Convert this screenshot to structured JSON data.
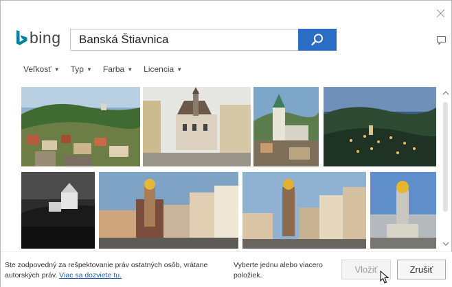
{
  "header": {
    "brand_text": "bing",
    "brand_color": "#00809d"
  },
  "search": {
    "query": "Banská Štiavnica",
    "button_color": "#2b6cc4",
    "icon": "search-icon"
  },
  "filters": [
    {
      "label": "Veľkosť"
    },
    {
      "label": "Typ"
    },
    {
      "label": "Farba"
    },
    {
      "label": "Licencia"
    }
  ],
  "footer": {
    "legal_text": "Ste zodpovedný za rešpektovanie práv ostatných osôb, vrátane autorských práv. ",
    "legal_link": "Viac sa dozviete tu.",
    "hint": "Vyberte jednu alebo viacero položiek.",
    "insert_label": "Vložiť",
    "cancel_label": "Zrušiť"
  }
}
